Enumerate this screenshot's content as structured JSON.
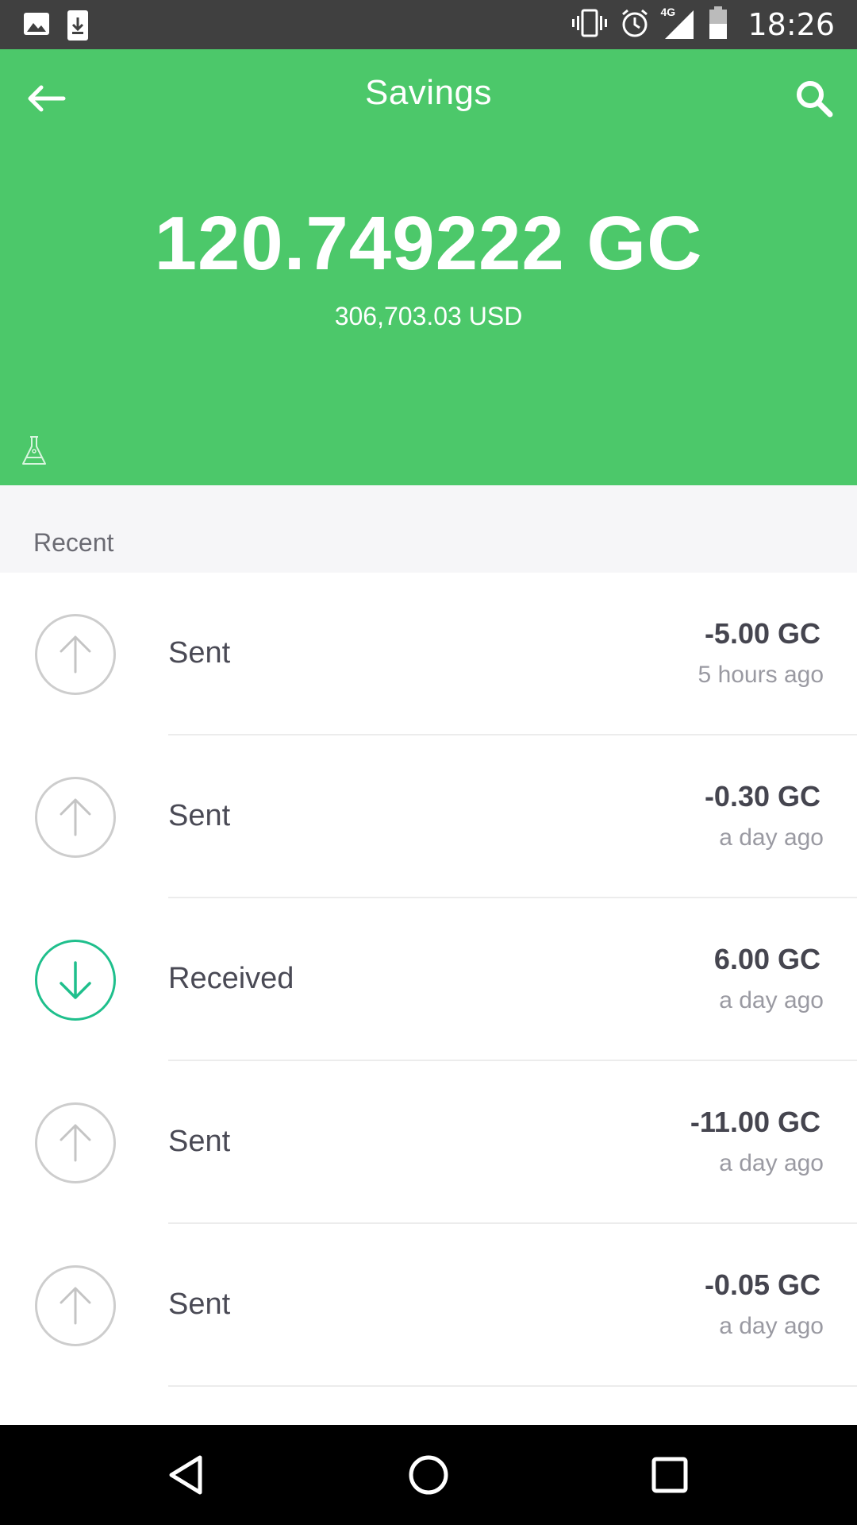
{
  "status_bar": {
    "time": "18:26",
    "network": "4G",
    "icons": [
      "image-icon",
      "download-icon",
      "vibrate-icon",
      "alarm-icon",
      "signal-icon",
      "battery-icon"
    ]
  },
  "header": {
    "title": "Savings",
    "balance": "120.749222 GC",
    "fiat": "306,703.03 USD",
    "color": "#4cc86a",
    "back_icon": "arrow-left-icon",
    "search_icon": "search-icon",
    "lab_icon": "flask-icon"
  },
  "section": {
    "label": "Recent"
  },
  "transactions": [
    {
      "type": "sent",
      "label": "Sent",
      "amount": "-5.00 GC",
      "time": "5 hours ago",
      "icon": "arrow-up-icon"
    },
    {
      "type": "sent",
      "label": "Sent",
      "amount": "-0.30 GC",
      "time": "a day ago",
      "icon": "arrow-up-icon"
    },
    {
      "type": "received",
      "label": "Received",
      "amount": "6.00 GC",
      "time": "a day ago",
      "icon": "arrow-down-icon"
    },
    {
      "type": "sent",
      "label": "Sent",
      "amount": "-11.00 GC",
      "time": "a day ago",
      "icon": "arrow-up-icon"
    },
    {
      "type": "sent",
      "label": "Sent",
      "amount": "-0.05 GC",
      "time": "a day ago",
      "icon": "arrow-up-icon"
    }
  ],
  "colors": {
    "received_accent": "#1fbf8c",
    "sent_outline": "#cdcdcd"
  },
  "nav_bar": {
    "buttons": [
      "back-triangle-icon",
      "home-circle-icon",
      "recents-square-icon"
    ]
  }
}
